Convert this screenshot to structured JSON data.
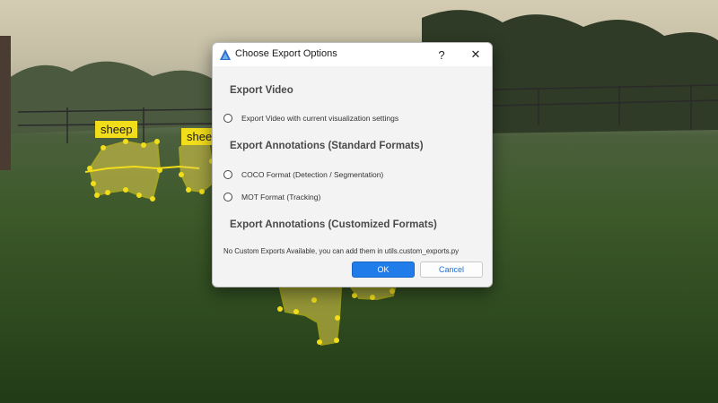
{
  "scene": {
    "labels": [
      "sheep",
      "sheep"
    ],
    "annotation_color": "#f2dd1b"
  },
  "dialog": {
    "title": "Choose Export Options",
    "help_label": "?",
    "close_label": "✕",
    "section_video": "Export Video",
    "option_video": "Export Video with current visualization settings",
    "section_standard": "Export Annotations (Standard Formats)",
    "option_coco": "COCO Format (Detection / Segmentation)",
    "option_mot": "MOT Format (Tracking)",
    "section_custom": "Export Annotations (Customized Formats)",
    "custom_info": "No Custom Exports Available, you can add them in utils.custom_exports.py",
    "ok_label": "OK",
    "cancel_label": "Cancel"
  },
  "colors": {
    "accent": "#1f7ce8",
    "dialog_bg": "#f3f3f3"
  }
}
